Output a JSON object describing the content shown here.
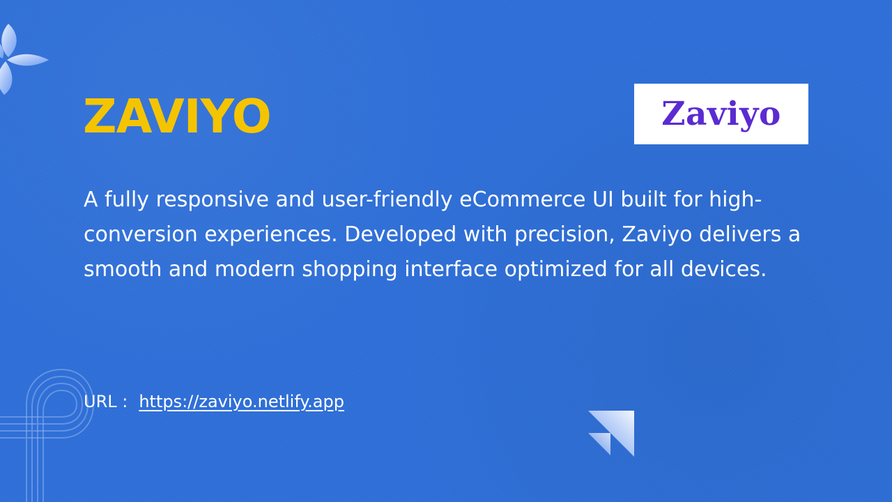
{
  "brand": {
    "title": "ZAVIYO",
    "logo_text": "Zaviyo"
  },
  "main": {
    "description": "A fully responsive and user-friendly eCommerce UI built for high-conversion experiences. Developed with precision, Zaviyo delivers a smooth and modern shopping interface optimized for all devices."
  },
  "url": {
    "label": "URL :",
    "link_text": "https://zaviyo.netlify.app"
  },
  "colors": {
    "background": "#2f6fd8",
    "title": "#f5c400",
    "logo_background": "#ffffff",
    "logo_text": "#5b2bd1"
  },
  "icons": {
    "top_left": "flower-icon",
    "bottom_left": "outline-loop-icon",
    "bottom_center": "arrow-icon"
  }
}
